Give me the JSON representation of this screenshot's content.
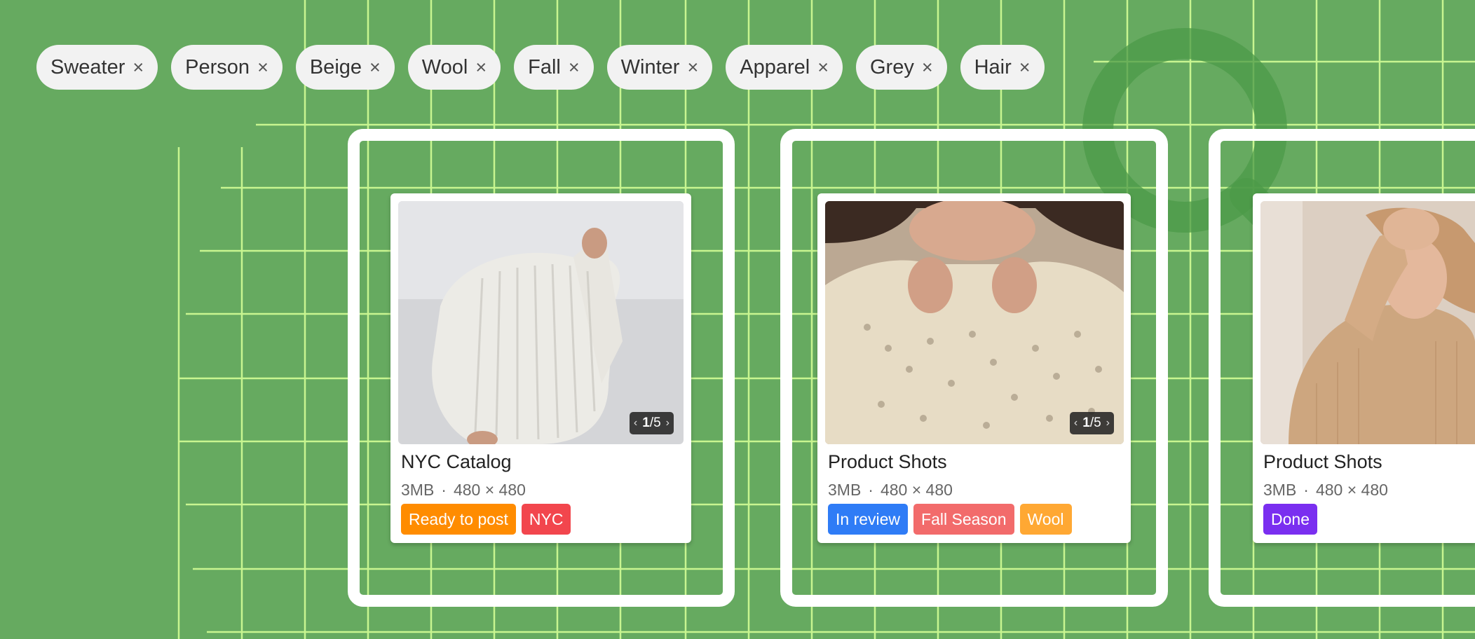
{
  "tags": [
    {
      "label": "Sweater"
    },
    {
      "label": "Person"
    },
    {
      "label": "Beige"
    },
    {
      "label": "Wool"
    },
    {
      "label": "Fall"
    },
    {
      "label": "Winter"
    },
    {
      "label": "Apparel"
    },
    {
      "label": "Grey"
    },
    {
      "label": "Hair"
    }
  ],
  "remove_glyph": "×",
  "cards": [
    {
      "title": "NYC Catalog",
      "size": "3MB",
      "dimensions": "480 × 480",
      "pager": {
        "current": "1",
        "total": "/5"
      },
      "labels": [
        {
          "text": "Ready to post",
          "color": "#ff8c00"
        },
        {
          "text": "NYC",
          "color": "#f2464d"
        }
      ]
    },
    {
      "title": "Product Shots",
      "size": "3MB",
      "dimensions": "480 × 480",
      "pager": {
        "current": "1",
        "total": "/5"
      },
      "labels": [
        {
          "text": "In review",
          "color": "#2f7cf6"
        },
        {
          "text": "Fall Season",
          "color": "#f26b6b"
        },
        {
          "text": "Wool",
          "color": "#ffa833"
        }
      ]
    },
    {
      "title": "Product Shots",
      "size": "3MB",
      "dimensions": "480 × 480",
      "labels": [
        {
          "text": "Done",
          "color": "#7a2ff0"
        }
      ]
    }
  ],
  "meta_separator": "·",
  "colors": {
    "background": "#66aa60",
    "grid_lines": "#c8f590",
    "frame": "#ffffff",
    "magnifier": "#4c9a48"
  }
}
